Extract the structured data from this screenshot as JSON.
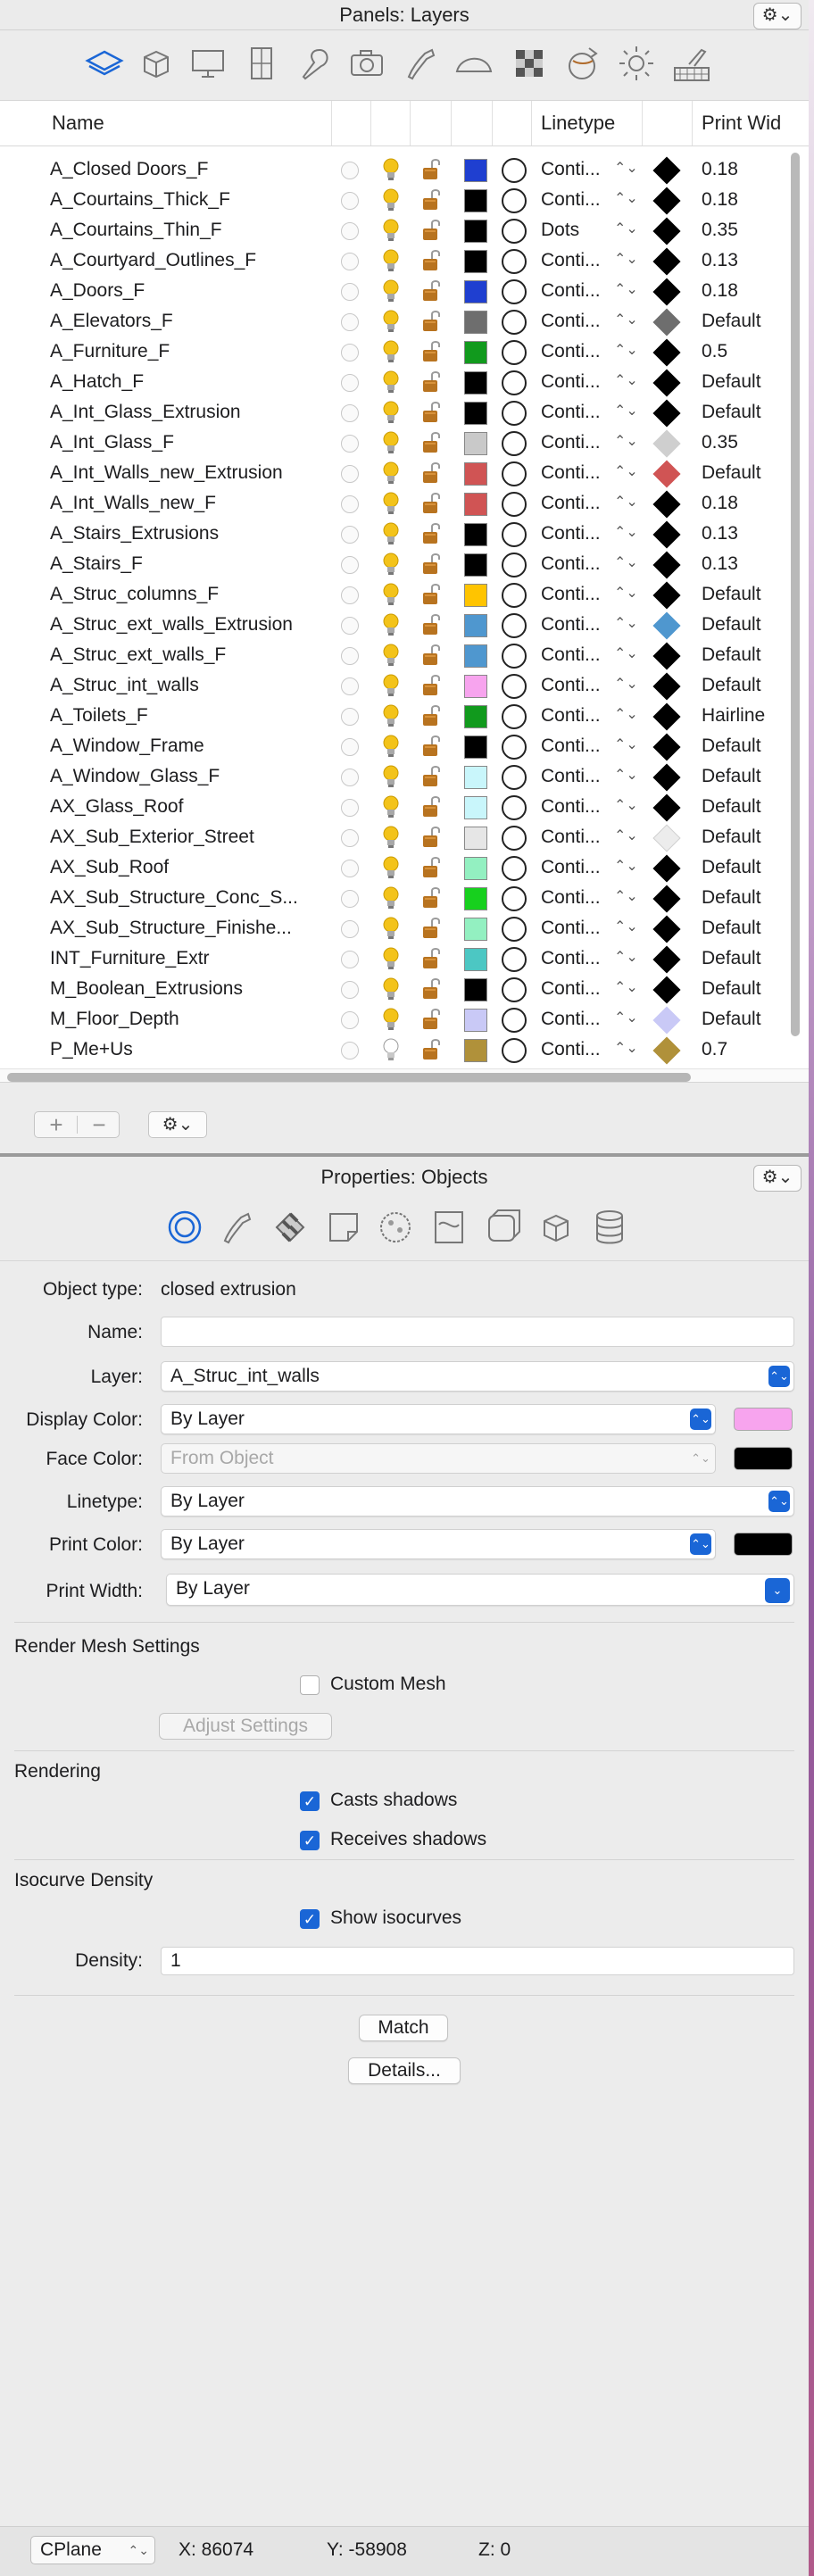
{
  "layers_panel": {
    "title": "Panels: Layers",
    "gear_label": "⚙︎⌄",
    "columns": {
      "name": "Name",
      "linetype": "Linetype",
      "print_width": "Print Wid"
    },
    "rows": [
      {
        "name": "A_Closed Doors_F",
        "color": "#1f3fd0",
        "linetype": "Conti...",
        "print_color": "#000000",
        "print_width": "0.18",
        "visible": true
      },
      {
        "name": "A_Courtains_Thick_F",
        "color": "#000000",
        "linetype": "Conti...",
        "print_color": "#000000",
        "print_width": "0.18",
        "visible": true
      },
      {
        "name": "A_Courtains_Thin_F",
        "color": "#000000",
        "linetype": "Dots",
        "print_color": "#000000",
        "print_width": "0.35",
        "visible": true
      },
      {
        "name": "A_Courtyard_Outlines_F",
        "color": "#000000",
        "linetype": "Conti...",
        "print_color": "#000000",
        "print_width": "0.13",
        "visible": true
      },
      {
        "name": "A_Doors_F",
        "color": "#1f3fd0",
        "linetype": "Conti...",
        "print_color": "#000000",
        "print_width": "0.18",
        "visible": true
      },
      {
        "name": "A_Elevators_F",
        "color": "#6e6e6e",
        "linetype": "Conti...",
        "print_color": "#6e6e6e",
        "print_width": "Default",
        "visible": true
      },
      {
        "name": "A_Furniture_F",
        "color": "#119a1d",
        "linetype": "Conti...",
        "print_color": "#000000",
        "print_width": "0.5",
        "visible": true
      },
      {
        "name": "A_Hatch_F",
        "color": "#000000",
        "linetype": "Conti...",
        "print_color": "#000000",
        "print_width": "Default",
        "visible": true
      },
      {
        "name": "A_Int_Glass_Extrusion",
        "color": "#000000",
        "linetype": "Conti...",
        "print_color": "#000000",
        "print_width": "Default",
        "visible": true
      },
      {
        "name": "A_Int_Glass_F",
        "color": "#c9c9c9",
        "linetype": "Conti...",
        "print_color": "#cfcfcf",
        "print_width": "0.35",
        "visible": true
      },
      {
        "name": "A_Int_Walls_new_Extrusion",
        "color": "#d05454",
        "linetype": "Conti...",
        "print_color": "#d05454",
        "print_width": "Default",
        "visible": true
      },
      {
        "name": "A_Int_Walls_new_F",
        "color": "#d05454",
        "linetype": "Conti...",
        "print_color": "#000000",
        "print_width": "0.18",
        "visible": true
      },
      {
        "name": "A_Stairs_Extrusions",
        "color": "#000000",
        "linetype": "Conti...",
        "print_color": "#000000",
        "print_width": "0.13",
        "visible": true
      },
      {
        "name": "A_Stairs_F",
        "color": "#000000",
        "linetype": "Conti...",
        "print_color": "#000000",
        "print_width": "0.13",
        "visible": true
      },
      {
        "name": "A_Struc_columns_F",
        "color": "#ffc400",
        "linetype": "Conti...",
        "print_color": "#000000",
        "print_width": "Default",
        "visible": true
      },
      {
        "name": "A_Struc_ext_walls_Extrusion",
        "color": "#4f97cf",
        "linetype": "Conti...",
        "print_color": "#4f97cf",
        "print_width": "Default",
        "visible": true
      },
      {
        "name": "A_Struc_ext_walls_F",
        "color": "#4f97cf",
        "linetype": "Conti...",
        "print_color": "#000000",
        "print_width": "Default",
        "visible": true
      },
      {
        "name": "A_Struc_int_walls",
        "color": "#f7a4ee",
        "linetype": "Conti...",
        "print_color": "#000000",
        "print_width": "Default",
        "visible": true
      },
      {
        "name": "A_Toilets_F",
        "color": "#119a1d",
        "linetype": "Conti...",
        "print_color": "#000000",
        "print_width": "Hairline",
        "visible": true
      },
      {
        "name": "A_Window_Frame",
        "color": "#000000",
        "linetype": "Conti...",
        "print_color": "#000000",
        "print_width": "Default",
        "visible": true
      },
      {
        "name": "A_Window_Glass_F",
        "color": "#c9f6fb",
        "linetype": "Conti...",
        "print_color": "#000000",
        "print_width": "Default",
        "visible": true
      },
      {
        "name": "AX_Glass_Roof",
        "color": "#c9f6fb",
        "linetype": "Conti...",
        "print_color": "#000000",
        "print_width": "Default",
        "visible": true
      },
      {
        "name": "AX_Sub_Exterior_Street",
        "color": "#e6e6e6",
        "linetype": "Conti...",
        "print_color": "#ececec",
        "print_width": "Default",
        "visible": true
      },
      {
        "name": "AX_Sub_Roof",
        "color": "#93f0c1",
        "linetype": "Conti...",
        "print_color": "#000000",
        "print_width": "Default",
        "visible": true
      },
      {
        "name": "AX_Sub_Structure_Conc_S...",
        "color": "#17d01e",
        "linetype": "Conti...",
        "print_color": "#000000",
        "print_width": "Default",
        "visible": true
      },
      {
        "name": "AX_Sub_Structure_Finishe...",
        "color": "#93f0c1",
        "linetype": "Conti...",
        "print_color": "#000000",
        "print_width": "Default",
        "visible": true
      },
      {
        "name": "INT_Furniture_Extr",
        "color": "#4cc7c3",
        "linetype": "Conti...",
        "print_color": "#000000",
        "print_width": "Default",
        "visible": true
      },
      {
        "name": "M_Boolean_Extrusions",
        "color": "#000000",
        "linetype": "Conti...",
        "print_color": "#000000",
        "print_width": "Default",
        "visible": true
      },
      {
        "name": "M_Floor_Depth",
        "color": "#c9c9f6",
        "linetype": "Conti...",
        "print_color": "#c9c9f6",
        "print_width": "Default",
        "visible": true
      },
      {
        "name": "P_Me+Us",
        "color": "#b0913a",
        "linetype": "Conti...",
        "print_color": "#b0913a",
        "print_width": "0.7",
        "visible": false
      }
    ],
    "add_label": "+",
    "remove_label": "−",
    "options_label": "⚙︎⌄"
  },
  "properties_panel": {
    "title": "Properties: Objects",
    "gear_label": "⚙︎⌄",
    "object_type_label": "Object type:",
    "object_type_value": "closed extrusion",
    "name_label": "Name:",
    "name_value": "",
    "layer_label": "Layer:",
    "layer_value": "A_Struc_int_walls",
    "display_color_label": "Display Color:",
    "display_color_value": "By Layer",
    "display_color_swatch": "#f7a4ee",
    "face_color_label": "Face Color:",
    "face_color_value": "From Object",
    "face_color_swatch": "#000000",
    "linetype_label": "Linetype:",
    "linetype_value": "By Layer",
    "print_color_label": "Print Color:",
    "print_color_value": "By Layer",
    "print_color_swatch": "#000000",
    "print_width_label": "Print Width:",
    "print_width_value": "By Layer",
    "render_mesh_section": "Render Mesh Settings",
    "custom_mesh_label": "Custom Mesh",
    "custom_mesh_checked": false,
    "adjust_settings_label": "Adjust Settings",
    "rendering_section": "Rendering",
    "casts_shadows_label": "Casts shadows",
    "casts_shadows_checked": true,
    "receives_shadows_label": "Receives shadows",
    "receives_shadows_checked": true,
    "isocurve_section": "Isocurve Density",
    "show_isocurves_label": "Show isocurves",
    "show_isocurves_checked": true,
    "density_label": "Density:",
    "density_value": "1",
    "match_label": "Match",
    "details_label": "Details..."
  },
  "status_bar": {
    "cplane_label": "CPlane",
    "x_label": "X: 86074",
    "y_label": "Y: -58908",
    "z_label": "Z: 0"
  },
  "colors": {
    "accent": "#1a66d6",
    "bulb": "#f3c31a",
    "lock": "#b8731f"
  }
}
